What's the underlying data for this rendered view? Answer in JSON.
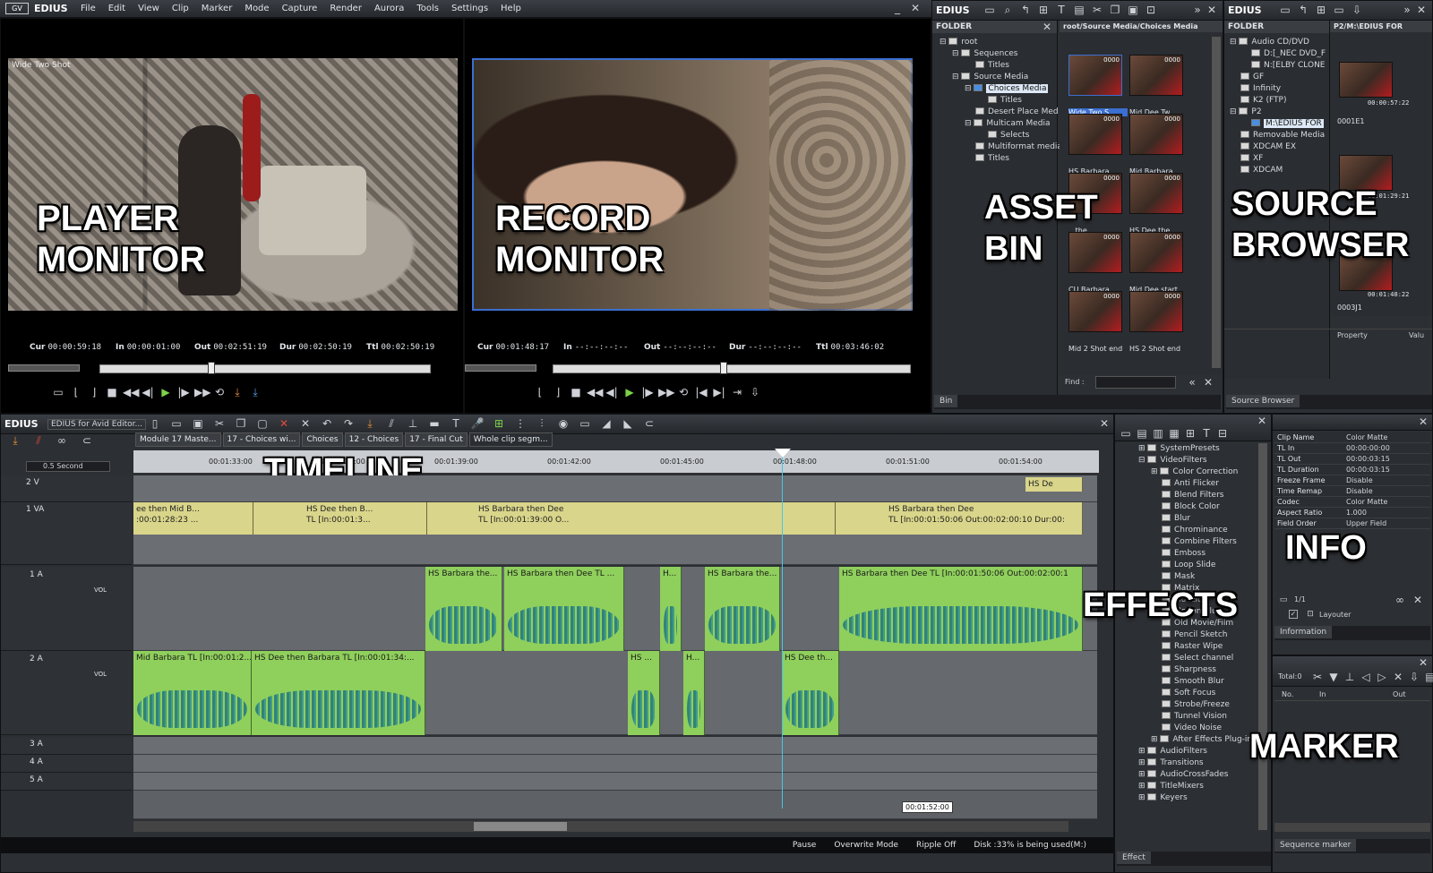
{
  "app": {
    "name": "EDIUS",
    "menu": [
      "File",
      "Edit",
      "View",
      "Clip",
      "Marker",
      "Mode",
      "Capture",
      "Render",
      "Aurora",
      "Tools",
      "Settings",
      "Help"
    ]
  },
  "player": {
    "label": "PLAYER\nMONITOR",
    "overlay": "Wide Two Shot",
    "cur": "00:00:59:18",
    "in": "00:00:01:00",
    "out": "00:02:51:19",
    "dur": "00:02:50:19",
    "ttl": "00:02:50:19"
  },
  "recorder": {
    "label": "RECORD\nMONITOR",
    "cur": "00:01:48:17",
    "in": "--:--:--:--",
    "out": "--:--:--:--",
    "dur": "--:--:--:--",
    "ttl": "00:03:46:02"
  },
  "tc_labels": {
    "cur": "Cur",
    "in": "In",
    "out": "Out",
    "dur": "Dur",
    "ttl": "Ttl"
  },
  "bin": {
    "app": "EDIUS",
    "label": "ASSET\nBIN",
    "folder_header": "FOLDER",
    "path": "root/Source Media/Choices Media",
    "tree": [
      "root",
      "Sequences",
      "Titles",
      "Source Media",
      "Choices Media",
      "Titles",
      "Desert Place Med",
      "Multicam Media",
      "Selects",
      "Multiformat media",
      "Titles"
    ],
    "clips": [
      "Wide Two S...",
      "Mid Dee Tw...",
      "HS Barbara ...",
      "Mid Barbara...",
      "...the...",
      "HS Dee the...",
      "CU Barbara ...",
      "Mid Dee start",
      "Mid 2 Shot end",
      "HS 2 Shot end"
    ],
    "clip_tc": "0000",
    "find_label": "Find :",
    "tab": "Bin"
  },
  "source_browser": {
    "app": "EDIUS",
    "label": "SOURCE\nBROWSER",
    "folder_header": "FOLDER",
    "path": "P2/M:\\EDIUS FOR",
    "tree": [
      "Audio CD/DVD",
      "D:[_NEC DVD_F",
      "N:[ELBY CLONE",
      "GF",
      "Infinity",
      "K2 (FTP)",
      "P2",
      "M:\\EDIUS FOR",
      "Removable Media",
      "XDCAM EX",
      "XF",
      "XDCAM"
    ],
    "clip_names": [
      "0001E1",
      "0003J1"
    ],
    "clip_tc": [
      "00:00:57:22",
      "00:01:29:21",
      "00:01:48:22"
    ],
    "property_label": "Property",
    "value_label": "Valu",
    "tab": "Source Browser"
  },
  "timeline": {
    "app": "EDIUS",
    "project": "EDIUS for Avid Editor...",
    "label": "TIMELINE",
    "scale": "0.5 Second",
    "tabs": [
      "Module 17 Maste...",
      "17 - Choices wi...",
      "Choices",
      "12 - Choices",
      "17 - Final Cut",
      "Whole clip segm..."
    ],
    "ruler": [
      "00:01:33:00",
      "00:01:36:00",
      "00:01:39:00",
      "00:01:42:00",
      "00:01:45:00",
      "00:01:48:00",
      "00:01:51:00",
      "00:01:54:00"
    ],
    "tracks": [
      "2 V",
      "1 VA",
      "1 A",
      "2 A",
      "3 A",
      "4 A",
      "5 A"
    ],
    "vol": "VOL",
    "v2_clip": "HS De",
    "v1_clips": [
      {
        "t": "ee then Mid B...",
        "s": ":00:01:28:23 ..."
      },
      {
        "t": "HS Dee then B...",
        "s": "TL [In:00:01:3..."
      },
      {
        "t": "HS Barbara then Dee",
        "s": "TL [In:00:01:39:00 O..."
      },
      {
        "t": "HS Barbara then Dee",
        "s": "TL [In:00:01:50:06 Out:00:02:00:10 Dur:00:"
      }
    ],
    "a1_clips": [
      "HS Barbara the...",
      "HS Barbara then Dee  TL ...",
      "H...",
      "HS Barbara the...",
      "HS Barbara then Dee  TL [In:00:01:50:06 Out:00:02:00:1"
    ],
    "a2_clips": [
      "Mid Barbara  TL [In:00:01:2...",
      "HS Dee then Barbara  TL [In:00:01:34:...",
      "HS ...",
      "H...",
      "HS Dee th..."
    ],
    "cursor_tc": "00:01:52:00"
  },
  "effects": {
    "label": "EFFECTS",
    "tree": [
      "SystemPresets",
      "VideoFilters",
      "Color Correction",
      "Anti Flicker",
      "Blend Filters",
      "Block Color",
      "Blur",
      "Chrominance",
      "Combine Filters",
      "Emboss",
      "Loop Slide",
      "Mask",
      "Matrix",
      "Mosaic",
      "Motion Blur",
      "Old Movie/Film",
      "Pencil Sketch",
      "Raster Wipe",
      "Select channel",
      "Sharpness",
      "Smooth Blur",
      "Soft Focus",
      "Strobe/Freeze",
      "Tunnel Vision",
      "Video Noise",
      "After Effects Plug-in",
      "AudioFilters",
      "Transitions",
      "AudioCrossFades",
      "TitleMixers",
      "Keyers"
    ],
    "tab": "Effect"
  },
  "info": {
    "label": "INFO",
    "rows": [
      [
        "Clip Name",
        "Color Matte"
      ],
      [
        "TL In",
        "00:00:00:00"
      ],
      [
        "TL Out",
        "00:00:03:15"
      ],
      [
        "TL Duration",
        "00:00:03:15"
      ],
      [
        "Freeze Frame",
        "Disable"
      ],
      [
        "Time Remap",
        "Disable"
      ],
      [
        "Codec",
        "Color Matte"
      ],
      [
        "Aspect Ratio",
        "1.000"
      ],
      [
        "Field Order",
        "Upper Field"
      ]
    ],
    "page": "1/1",
    "layouter": "Layouter",
    "tab": "Information"
  },
  "marker": {
    "label": "MARKER",
    "total": "Total:0",
    "cols": [
      "No.",
      "In",
      "Out"
    ],
    "tab": "Sequence marker"
  },
  "status": {
    "items": [
      "Pause",
      "Overwrite Mode",
      "Ripple Off",
      "Disk :33% is being used(M:)"
    ]
  }
}
